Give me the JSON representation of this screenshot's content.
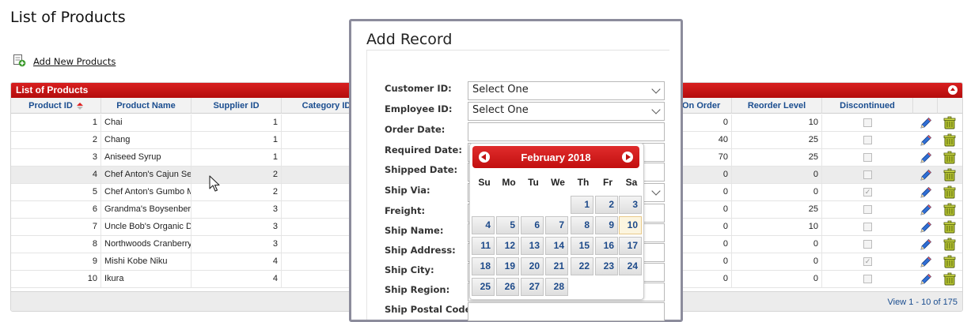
{
  "page": {
    "title": "List of Products",
    "add_link": "Add New Products"
  },
  "grid": {
    "caption": "List of Products",
    "columns": [
      "Product ID",
      "Product Name",
      "Supplier ID",
      "Category ID",
      "On Order",
      "Reorder Level",
      "Discontinued"
    ],
    "rows": [
      {
        "id": "1",
        "name": "Chai",
        "supplier": "1",
        "on_order": "0",
        "reorder": "10",
        "discontinued": false
      },
      {
        "id": "2",
        "name": "Chang",
        "supplier": "1",
        "on_order": "40",
        "reorder": "25",
        "discontinued": false
      },
      {
        "id": "3",
        "name": "Aniseed Syrup",
        "supplier": "1",
        "on_order": "70",
        "reorder": "25",
        "discontinued": false
      },
      {
        "id": "4",
        "name": "Chef Anton's Cajun Se",
        "supplier": "2",
        "on_order": "0",
        "reorder": "0",
        "discontinued": false
      },
      {
        "id": "5",
        "name": "Chef Anton's Gumbo M",
        "supplier": "2",
        "on_order": "0",
        "reorder": "0",
        "discontinued": true
      },
      {
        "id": "6",
        "name": "Grandma's Boysenberr",
        "supplier": "3",
        "on_order": "0",
        "reorder": "25",
        "discontinued": false
      },
      {
        "id": "7",
        "name": "Uncle Bob's Organic D",
        "supplier": "3",
        "on_order": "0",
        "reorder": "10",
        "discontinued": false
      },
      {
        "id": "8",
        "name": "Northwoods Cranberry",
        "supplier": "3",
        "on_order": "0",
        "reorder": "0",
        "discontinued": false
      },
      {
        "id": "9",
        "name": "Mishi Kobe Niku",
        "supplier": "4",
        "on_order": "0",
        "reorder": "0",
        "discontinued": true
      },
      {
        "id": "10",
        "name": "Ikura",
        "supplier": "4",
        "on_order": "0",
        "reorder": "0",
        "discontinued": false
      }
    ],
    "footer": "View 1 - 10 of 175"
  },
  "modal": {
    "title": "Add Record",
    "fields": [
      {
        "label": "Customer ID:",
        "value": "Select One"
      },
      {
        "label": "Employee ID:",
        "value": "Select One"
      },
      {
        "label": "Order Date:",
        "value": ""
      },
      {
        "label": "Required Date:",
        "value": ""
      },
      {
        "label": "Shipped Date:",
        "value": ""
      },
      {
        "label": "Ship Via:",
        "value": ""
      },
      {
        "label": "Freight:",
        "value": ""
      },
      {
        "label": "Ship Name:",
        "value": ""
      },
      {
        "label": "Ship Address:",
        "value": ""
      },
      {
        "label": "Ship City:",
        "value": ""
      },
      {
        "label": "Ship Region:",
        "value": ""
      },
      {
        "label": "Ship Postal Code:",
        "value": ""
      }
    ]
  },
  "calendar": {
    "title": "February 2018",
    "weekdays": [
      "Su",
      "Mo",
      "Tu",
      "We",
      "Th",
      "Fr",
      "Sa"
    ],
    "days": [
      "1",
      "2",
      "3",
      "4",
      "5",
      "6",
      "7",
      "8",
      "9",
      "10",
      "11",
      "12",
      "13",
      "14",
      "15",
      "16",
      "17",
      "18",
      "19",
      "20",
      "21",
      "22",
      "23",
      "24",
      "25",
      "26",
      "27",
      "28"
    ],
    "today": "10"
  },
  "colors": {
    "accent": "#c81414",
    "link": "#1a4d8f"
  }
}
